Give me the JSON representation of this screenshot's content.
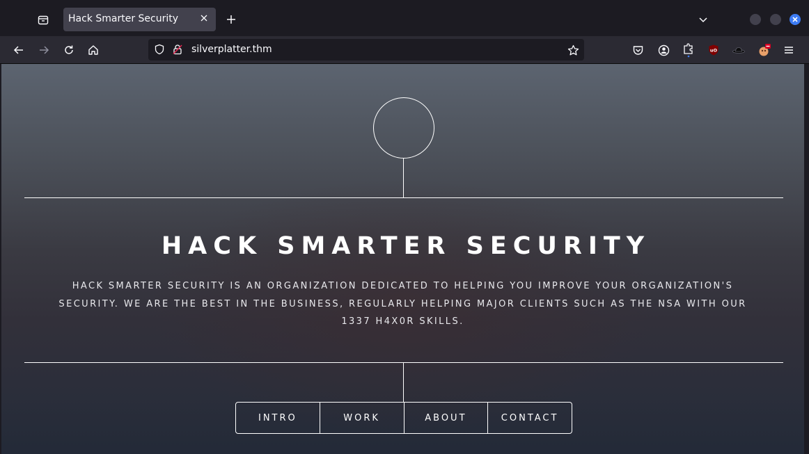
{
  "browser": {
    "tab": {
      "title": "Hack Smarter Security"
    },
    "url": "silverplatter.thm",
    "toolbar_icons": [
      "pocket-icon",
      "account-icon",
      "extensions-icon",
      "ublock-icon",
      "hat-icon",
      "addon-icon",
      "menu-icon"
    ]
  },
  "page": {
    "title": "HACK SMARTER SECURITY",
    "description": "Hack Smarter Security is an organization dedicated to helping you improve your organization's security. We are the best in the business, regularly helping major clients such as the NSA with our 1337 H4X0R skills.",
    "nav": [
      {
        "label": "INTRO"
      },
      {
        "label": "WORK"
      },
      {
        "label": "ABOUT"
      },
      {
        "label": "CONTACT"
      }
    ]
  },
  "colors": {
    "accent_blue": "#3d7cf4",
    "tab_bg": "#42414d",
    "toolbar_bg": "#2b2a33",
    "frame_bg": "#1c1b22"
  }
}
